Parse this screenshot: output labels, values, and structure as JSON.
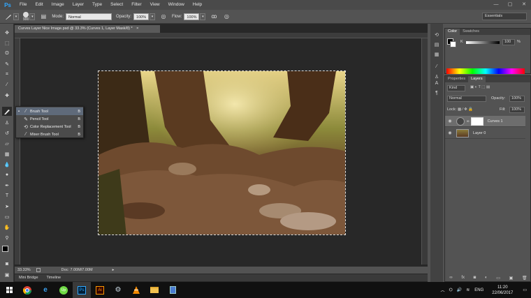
{
  "app": {
    "logo": "Ps"
  },
  "menu": [
    "File",
    "Edit",
    "Image",
    "Layer",
    "Type",
    "Select",
    "Filter",
    "View",
    "Window",
    "Help"
  ],
  "window_controls": [
    "—",
    "▢",
    "✕"
  ],
  "options": {
    "brush_size": "900",
    "mode_label": "Mode:",
    "mode_value": "Normal",
    "opacity_label": "Opacity:",
    "opacity_value": "100%",
    "flow_label": "Flow:",
    "flow_value": "100%",
    "workspace": "Essentials"
  },
  "document": {
    "tab_title": "Curves Layer Nice Image.psd @ 33.3% (Curves 1, Layer Mask/8) *",
    "tab_close": "×",
    "zoom": "33.33%",
    "doc_info": "Doc: 7.00M/7.00M",
    "bottom_tabs": [
      "Mini Bridge",
      "Timeline"
    ]
  },
  "flyout": {
    "items": [
      {
        "label": "Brush Tool",
        "key": "B",
        "selected": true
      },
      {
        "label": "Pencil Tool",
        "key": "B",
        "selected": false
      },
      {
        "label": "Color Replacement Tool",
        "key": "B",
        "selected": false
      },
      {
        "label": "Mixer Brush Tool",
        "key": "B",
        "selected": false
      }
    ]
  },
  "color_panel": {
    "tabs": [
      "Color",
      "Swatches"
    ],
    "slider_label": "K",
    "slider_value": "100",
    "slider_unit": "%"
  },
  "layers_panel": {
    "tabs": [
      "Properties",
      "Layers"
    ],
    "filter_kind": "Kind",
    "blend_mode": "Normal",
    "opacity_label": "Opacity:",
    "opacity_value": "100%",
    "lock_label": "Lock:",
    "fill_label": "Fill:",
    "fill_value": "100%",
    "layers": [
      {
        "name": "Curves 1",
        "selected": true
      },
      {
        "name": "Layer 0",
        "selected": false
      }
    ],
    "footer_icons": [
      "link-icon",
      "fx-icon",
      "mask-icon",
      "adjustment-icon",
      "folder-icon",
      "new-layer-icon",
      "trash-icon"
    ]
  },
  "taskbar": {
    "apps": [
      "windows-icon",
      "chrome-icon",
      "ie-icon",
      "upwork-icon",
      "photoshop-icon",
      "illustrator-icon",
      "steam-icon",
      "vlc-icon",
      "explorer-icon",
      "notes-icon"
    ],
    "ps_label": "Ps",
    "ai_label": "Ai",
    "lang": "ENG",
    "time": "11:20",
    "date": "22/06/2017"
  },
  "colors": {
    "accent": "#31a8ff",
    "panel": "#535353",
    "canvas": "#282828"
  }
}
